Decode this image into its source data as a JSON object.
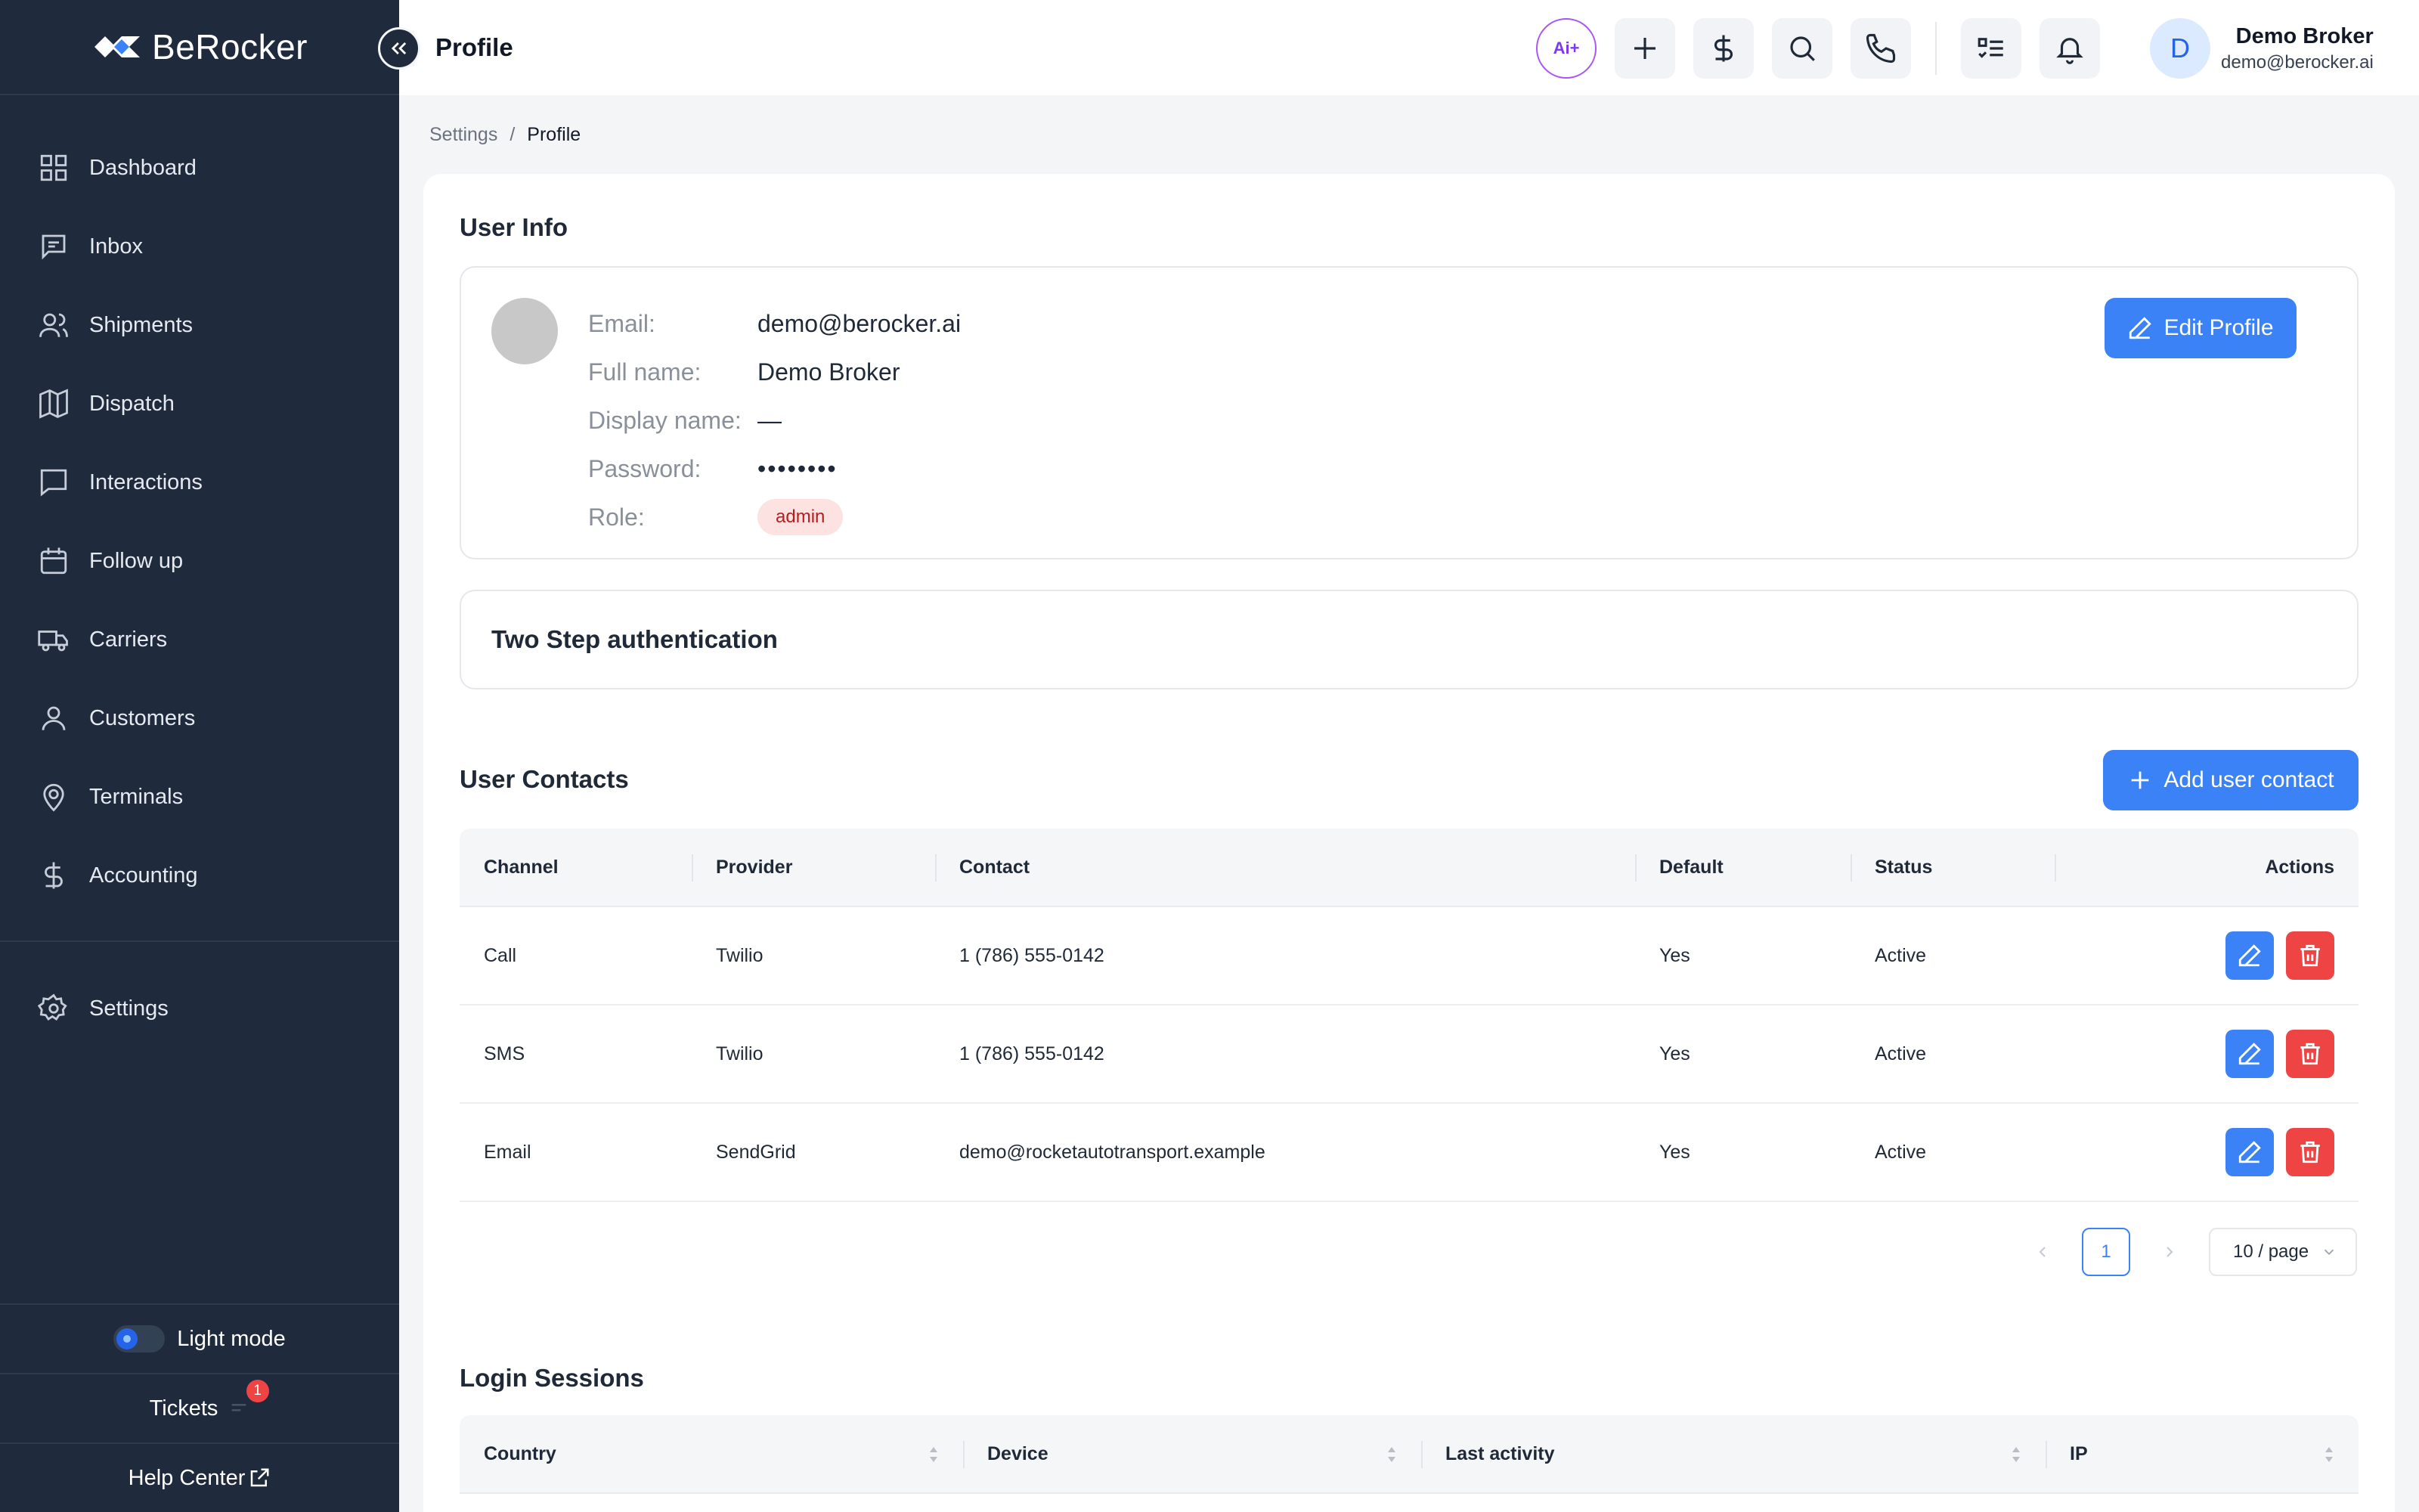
{
  "app": {
    "name": "BeRocker"
  },
  "sidebar": {
    "items": [
      {
        "label": "Dashboard",
        "icon": "grid-icon"
      },
      {
        "label": "Inbox",
        "icon": "message-square-icon"
      },
      {
        "label": "Shipments",
        "icon": "users-icon"
      },
      {
        "label": "Dispatch",
        "icon": "map-icon"
      },
      {
        "label": "Interactions",
        "icon": "message-icon"
      },
      {
        "label": "Follow up",
        "icon": "calendar-icon"
      },
      {
        "label": "Carriers",
        "icon": "truck-icon"
      },
      {
        "label": "Customers",
        "icon": "user-icon"
      },
      {
        "label": "Terminals",
        "icon": "map-pin-icon"
      },
      {
        "label": "Accounting",
        "icon": "dollar-icon"
      }
    ],
    "settings_label": "Settings",
    "light_mode_label": "Light mode",
    "tickets_label": "Tickets",
    "tickets_count": "1",
    "help_center_label": "Help Center"
  },
  "header": {
    "title": "Profile",
    "ai_label": "Ai+",
    "user_initial": "D",
    "user_name": "Demo Broker",
    "user_email": "demo@berocker.ai"
  },
  "breadcrumb": {
    "parent": "Settings",
    "separator": "/",
    "current": "Profile"
  },
  "user_info": {
    "title": "User Info",
    "email_label": "Email:",
    "email": "demo@berocker.ai",
    "fullname_label": "Full name:",
    "fullname": "Demo Broker",
    "display_label": "Display name:",
    "display": "—",
    "password_label": "Password:",
    "password": "••••••••",
    "role_label": "Role:",
    "role": "admin",
    "edit_label": "Edit Profile"
  },
  "two_step": {
    "title": "Two Step authentication"
  },
  "contacts": {
    "title": "User Contacts",
    "add_label": "Add user contact",
    "columns": [
      "Channel",
      "Provider",
      "Contact",
      "Default",
      "Status",
      "Actions"
    ],
    "rows": [
      {
        "channel": "Call",
        "provider": "Twilio",
        "contact": "1 (786) 555-0142",
        "default": "Yes",
        "status": "Active"
      },
      {
        "channel": "SMS",
        "provider": "Twilio",
        "contact": "1 (786) 555-0142",
        "default": "Yes",
        "status": "Active"
      },
      {
        "channel": "Email",
        "provider": "SendGrid",
        "contact": "demo@rocketautotransport.example",
        "default": "Yes",
        "status": "Active"
      }
    ],
    "page": "1",
    "page_size": "10 / page"
  },
  "sessions": {
    "title": "Login Sessions",
    "columns": [
      "Country",
      "Device",
      "Last activity",
      "IP"
    ]
  },
  "colors": {
    "sidebar": "#1f2a3c",
    "primary": "#3b82f6",
    "danger": "#ef4444",
    "badge_bg": "#fde2e2"
  }
}
